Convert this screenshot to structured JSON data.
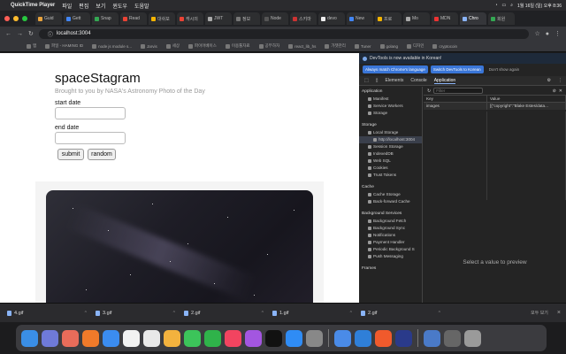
{
  "menubar": {
    "app": "QuickTime Player",
    "items": [
      "파일",
      "편집",
      "보기",
      "윈도우",
      "도움말"
    ],
    "clock": "1월 16일 (일) 오후 8:36"
  },
  "tabs": [
    "Guid",
    "Gett",
    "Snap",
    "Read",
    "대쉬보",
    "캐시의",
    "JWT",
    "정보",
    "Node",
    "스키마",
    "devo",
    "New",
    "프로",
    "Mo",
    "MDN",
    "Chro",
    "회원"
  ],
  "address": {
    "url": "localhost:3004"
  },
  "bookmarks": [
    "앱",
    "파일 - HAMING ID",
    "node js module s...",
    "Jarvis",
    "세상",
    "파이어베이스",
    "이용툴자료",
    "공부하자",
    "react_lib_hs",
    "가젯관리",
    "Tuner",
    "golang",
    "디자인",
    "cryptocoin"
  ],
  "page": {
    "title": "spaceStagram",
    "subtitle": "Brought to you by NASA's Astronomy Photo of the Day",
    "start_label": "start date",
    "end_label": "end date",
    "submit_label": "submit",
    "random_label": "random"
  },
  "devtools": {
    "info": "DevTools is now available in Korean!",
    "btn_match": "Always match Chrome's language",
    "btn_switch": "Switch DevTools to Korean",
    "btn_dont": "Don't show again",
    "tabs": [
      "Elements",
      "Console",
      "Application"
    ],
    "active_tab": "Application",
    "filter_placeholder": "Filter",
    "sections": [
      {
        "title": "Application",
        "items": [
          "Manifest",
          "Service Workers",
          "Storage"
        ]
      },
      {
        "title": "Storage",
        "items": [
          "Local Storage",
          "http://localhost:3004",
          "Session Storage",
          "IndexedDB",
          "Web SQL",
          "Cookies",
          "Trust Tokens"
        ]
      },
      {
        "title": "Cache",
        "items": [
          "Cache Storage",
          "Back-forward Cache"
        ]
      },
      {
        "title": "Background Services",
        "items": [
          "Background Fetch",
          "Background Sync",
          "Notifications",
          "Payment Handler",
          "Periodic Background S",
          "Push Messaging"
        ]
      },
      {
        "title": "Frames",
        "items": []
      }
    ],
    "table": {
      "key_header": "Key",
      "value_header": "Value",
      "key": "images",
      "value": "[{\"copyright\":\"Blake Estes/data..."
    },
    "preview": "Select a value to preview"
  },
  "downloads": {
    "files": [
      "4.gif",
      "3.gif",
      "2.gif",
      "1.gif",
      "2.gif"
    ],
    "show_all": "모두 보기"
  },
  "colors": {
    "devtools_blue": "#3a76d8",
    "page_bg": "#ffffff"
  }
}
